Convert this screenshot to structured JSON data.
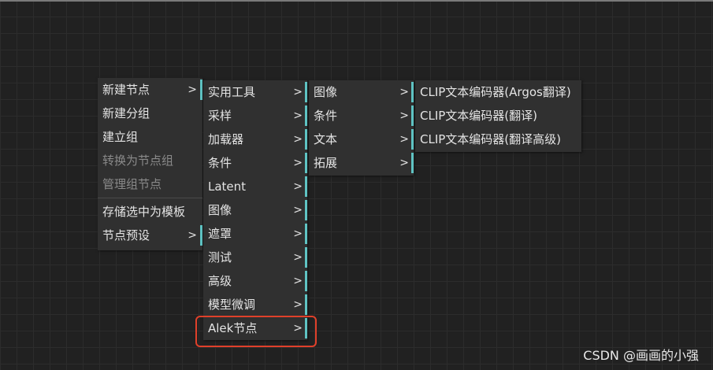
{
  "menu1": {
    "items": [
      {
        "label": "新建节点",
        "arrow": ">",
        "disabled": false
      },
      {
        "label": "新建分组",
        "disabled": false
      },
      {
        "label": "建立组",
        "disabled": false
      },
      {
        "label": "转换为节点组",
        "disabled": true
      },
      {
        "label": "管理组节点",
        "disabled": true
      },
      {
        "label": "存储选中为模板",
        "disabled": false
      },
      {
        "label": "节点预设",
        "arrow": ">",
        "disabled": false
      }
    ]
  },
  "menu2": {
    "items": [
      {
        "label": "实用工具",
        "arrow": ">"
      },
      {
        "label": "采样",
        "arrow": ">"
      },
      {
        "label": "加载器",
        "arrow": ">"
      },
      {
        "label": "条件",
        "arrow": ">"
      },
      {
        "label": "Latent",
        "arrow": ">"
      },
      {
        "label": "图像",
        "arrow": ">"
      },
      {
        "label": "遮罩",
        "arrow": ">"
      },
      {
        "label": "测试",
        "arrow": ">"
      },
      {
        "label": "高级",
        "arrow": ">"
      },
      {
        "label": "模型微调",
        "arrow": ">"
      },
      {
        "label": "Alek节点",
        "arrow": ">"
      }
    ]
  },
  "menu3": {
    "items": [
      {
        "label": "图像",
        "arrow": ">"
      },
      {
        "label": "条件",
        "arrow": ">"
      },
      {
        "label": "文本",
        "arrow": ">"
      },
      {
        "label": "拓展",
        "arrow": ">"
      }
    ]
  },
  "menu4": {
    "items": [
      {
        "label": "CLIP文本编码器(Argos翻译)"
      },
      {
        "label": "CLIP文本编码器(翻译)"
      },
      {
        "label": "CLIP文本编码器(翻译高级)"
      }
    ]
  },
  "colors": {
    "background": "#212121",
    "menu_bg": "#303030",
    "submenu_indicator": "#5fc3c3",
    "highlight_border": "#e0402a"
  },
  "watermark": "CSDN @画画的小强"
}
